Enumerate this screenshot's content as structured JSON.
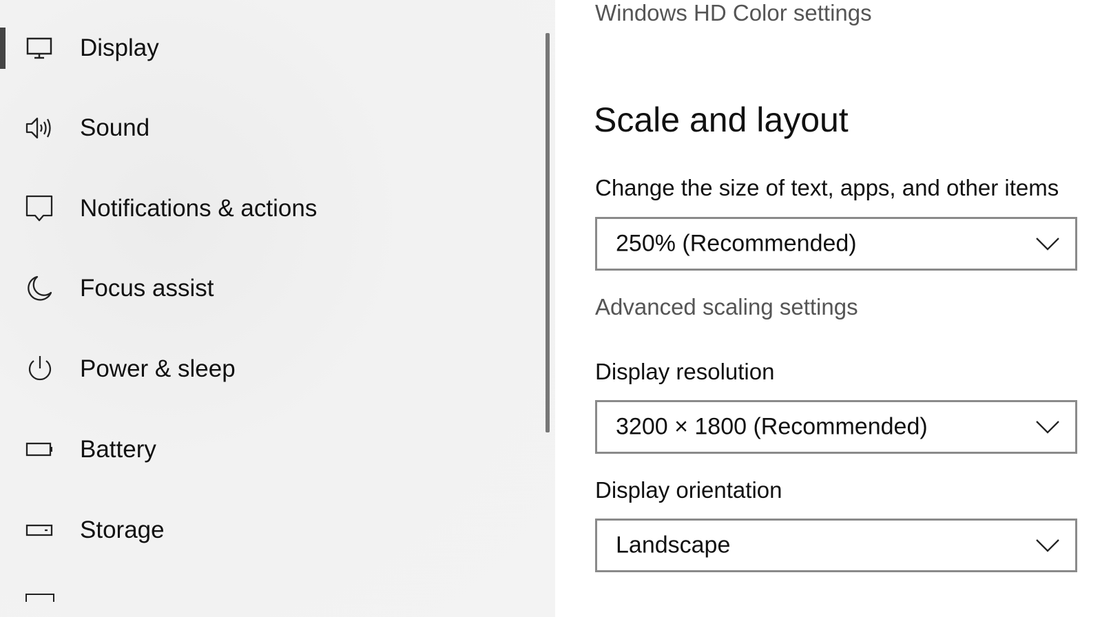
{
  "sidebar": {
    "items": [
      {
        "label": "Display",
        "icon": "monitor-icon",
        "active": true
      },
      {
        "label": "Sound",
        "icon": "speaker-icon"
      },
      {
        "label": "Notifications & actions",
        "icon": "message-icon"
      },
      {
        "label": "Focus assist",
        "icon": "moon-icon"
      },
      {
        "label": "Power & sleep",
        "icon": "power-icon"
      },
      {
        "label": "Battery",
        "icon": "battery-icon"
      },
      {
        "label": "Storage",
        "icon": "storage-icon"
      }
    ]
  },
  "main": {
    "hd_color_link": "Windows HD Color settings",
    "section_title": "Scale and layout",
    "scale": {
      "label": "Change the size of text, apps, and other items",
      "value": "250% (Recommended)"
    },
    "advanced_scaling_link": "Advanced scaling settings",
    "resolution": {
      "label": "Display resolution",
      "value": "3200 × 1800 (Recommended)"
    },
    "orientation": {
      "label": "Display orientation",
      "value": "Landscape"
    }
  },
  "colors": {
    "sidebar_bg": "#f2f2f2",
    "accent_bar": "#444444",
    "dropdown_border": "#8a8a8a",
    "link_text": "#555555"
  }
}
